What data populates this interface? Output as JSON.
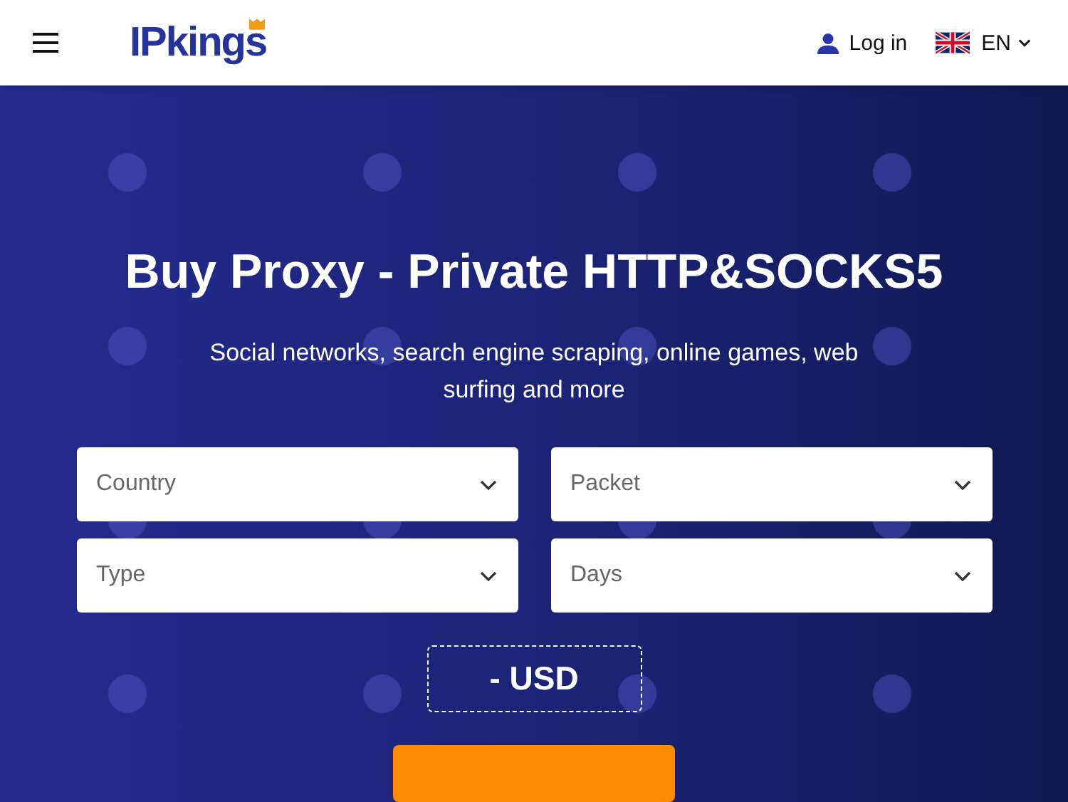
{
  "header": {
    "logo": "IPkings",
    "login": "Log in",
    "language": "EN"
  },
  "hero": {
    "title": "Buy Proxy - Private HTTP&SOCKS5",
    "subtitle": "Social networks, search engine scraping, online games, web surfing and more"
  },
  "selects": [
    {
      "placeholder": "Country"
    },
    {
      "placeholder": "Packet"
    },
    {
      "placeholder": "Type"
    },
    {
      "placeholder": "Days"
    }
  ],
  "price": "- USD"
}
